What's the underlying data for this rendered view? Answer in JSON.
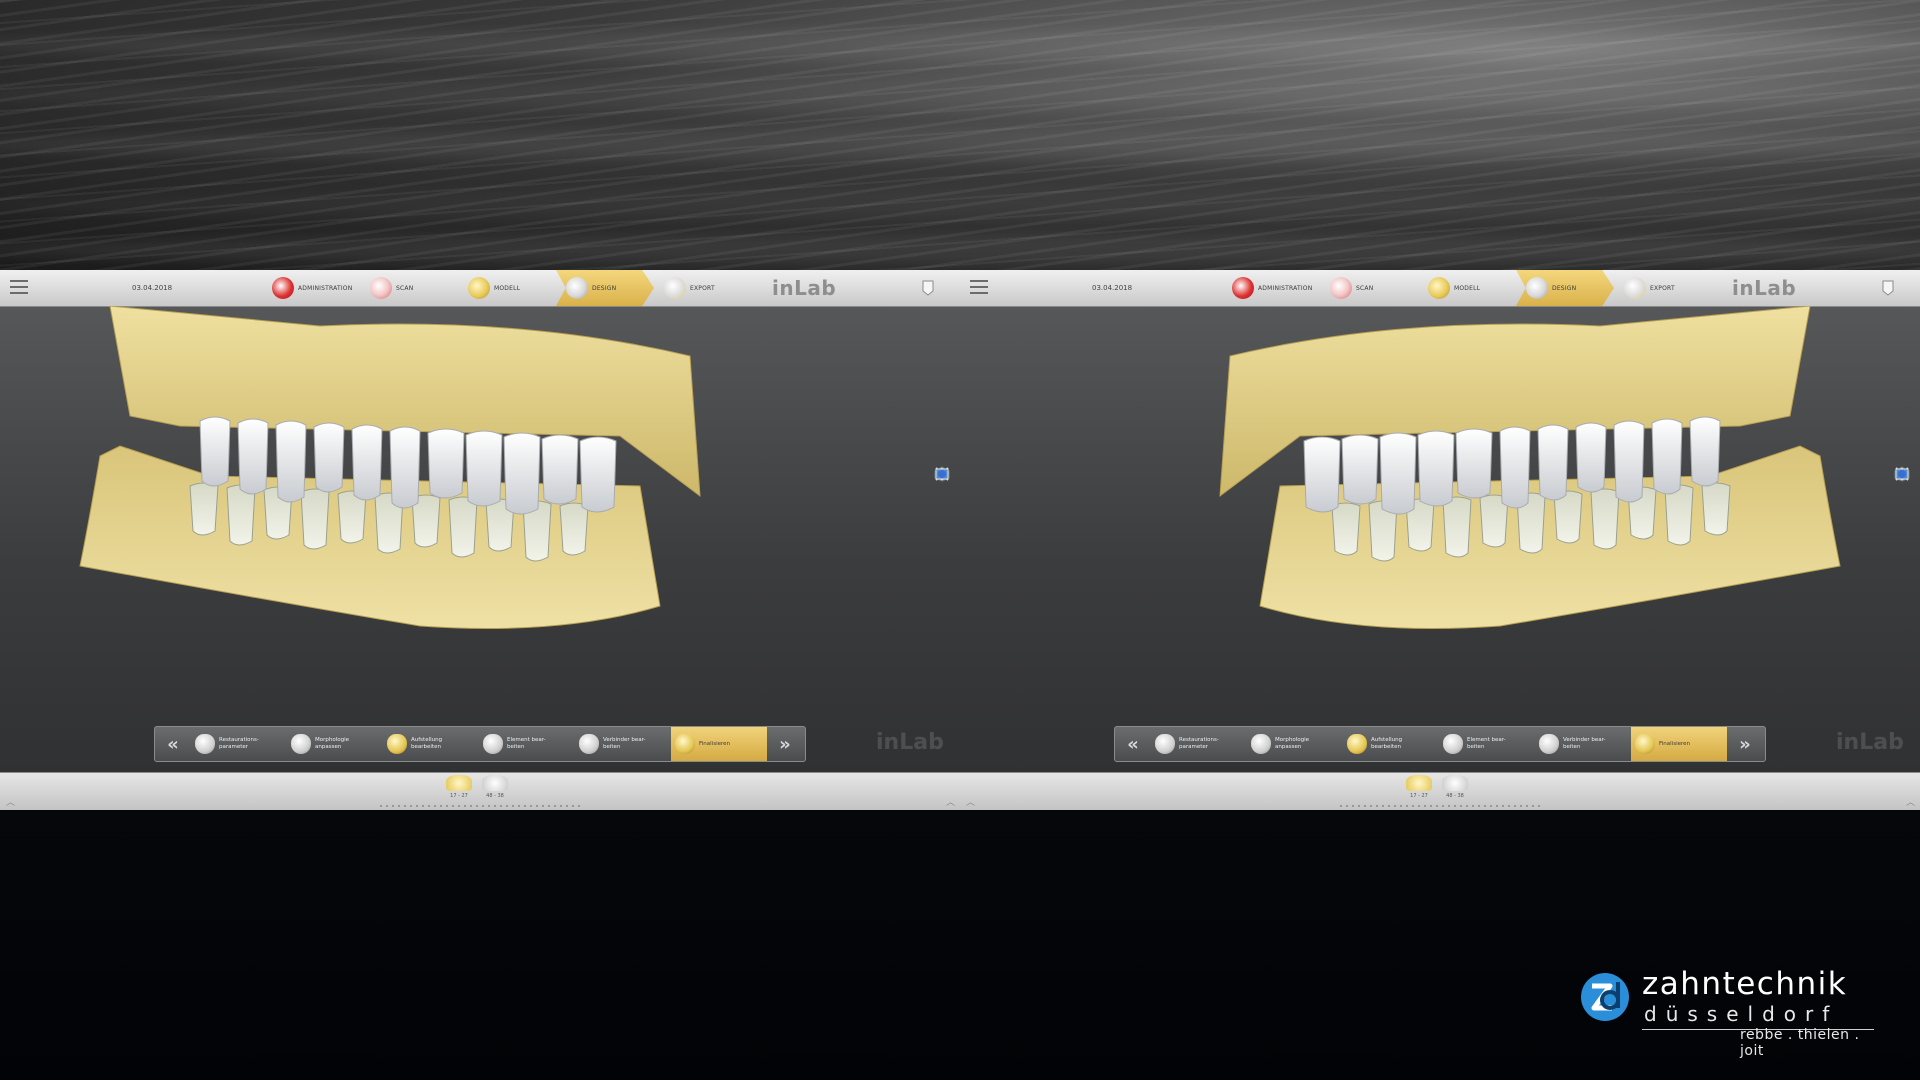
{
  "windows": [
    {
      "topbar": {
        "date": "03.04.2018",
        "steps": [
          {
            "label": "ADMINISTRATION",
            "icon": "administration-icon",
            "active": false
          },
          {
            "label": "SCAN",
            "icon": "scan-icon",
            "active": false
          },
          {
            "label": "MODELL",
            "icon": "model-icon",
            "active": false
          },
          {
            "label": "DESIGN",
            "icon": "design-icon",
            "active": true
          },
          {
            "label": "EXPORT",
            "icon": "export-icon",
            "active": false
          }
        ],
        "brand": "inLab"
      },
      "design_steps": [
        {
          "label": "Restaurations-\nparameter",
          "icon": "restoration-parameter-icon",
          "active": false
        },
        {
          "label": "Morphologie\nanpassen",
          "icon": "morphology-icon",
          "active": false
        },
        {
          "label": "Aufstellung\nbearbeiten",
          "icon": "setup-icon",
          "active": false
        },
        {
          "label": "Element bear-\nbeiten",
          "icon": "edit-element-icon",
          "active": false
        },
        {
          "label": "Verbinder bear-\nbeiten",
          "icon": "connector-icon",
          "active": false
        },
        {
          "label": "Finalisieren",
          "icon": "finalize-icon",
          "active": true
        }
      ],
      "watermark": "inLab",
      "jaws": [
        {
          "caption": "17 - 27",
          "active": true
        },
        {
          "caption": "48 - 38",
          "active": false
        }
      ]
    },
    {
      "topbar": {
        "date": "03.04.2018",
        "steps": [
          {
            "label": "ADMINISTRATION",
            "icon": "administration-icon",
            "active": false
          },
          {
            "label": "SCAN",
            "icon": "scan-icon",
            "active": false
          },
          {
            "label": "MODELL",
            "icon": "model-icon",
            "active": false
          },
          {
            "label": "DESIGN",
            "icon": "design-icon",
            "active": true
          },
          {
            "label": "EXPORT",
            "icon": "export-icon",
            "active": false
          }
        ],
        "brand": "inLab"
      },
      "design_steps": [
        {
          "label": "Restaurations-\nparameter",
          "icon": "restoration-parameter-icon",
          "active": false
        },
        {
          "label": "Morphologie\nanpassen",
          "icon": "morphology-icon",
          "active": false
        },
        {
          "label": "Aufstellung\nbearbeiten",
          "icon": "setup-icon",
          "active": false
        },
        {
          "label": "Element bear-\nbeiten",
          "icon": "edit-element-icon",
          "active": false
        },
        {
          "label": "Verbinder bear-\nbeiten",
          "icon": "connector-icon",
          "active": false
        },
        {
          "label": "Finalisieren",
          "icon": "finalize-icon",
          "active": true
        }
      ],
      "watermark": "inLab",
      "jaws": [
        {
          "caption": "17 - 27",
          "active": true
        },
        {
          "caption": "48 - 38",
          "active": false
        }
      ]
    }
  ],
  "side_tools": [
    "cube-view-icon",
    "tools-icon",
    "scan-tool-icon",
    "book-icon",
    "image-icon",
    "info-icon"
  ],
  "colors": {
    "model_yellow": "#e6d48c",
    "tooth_white": "#e9ebed",
    "active_step": "#e3bd55",
    "toolbar": "#dcdcdc"
  },
  "logo": {
    "name": "zahntechnik",
    "city": "düsseldorf",
    "partners": "rebbe . thielen . joit"
  }
}
